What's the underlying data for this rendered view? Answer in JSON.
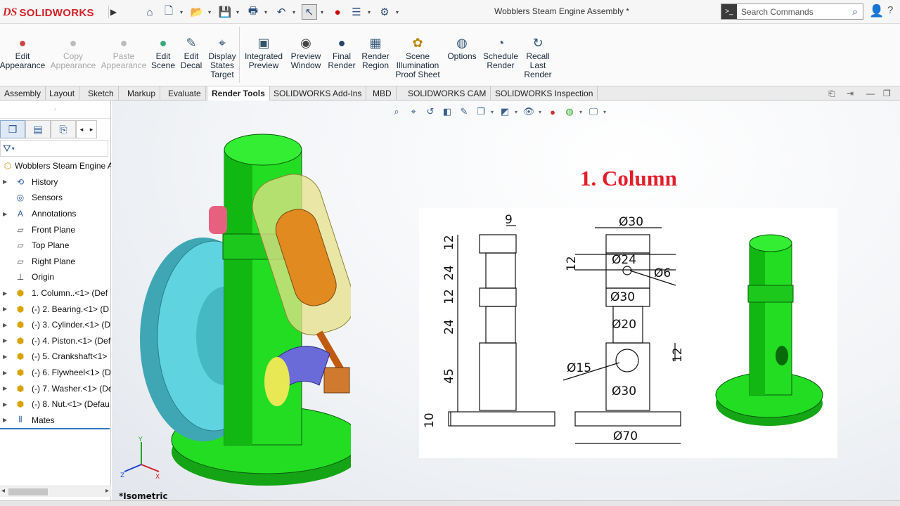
{
  "app": {
    "logo": {
      "mark": "DS",
      "name": "SOLIDWORKS"
    },
    "document_title": "Wobblers Steam Engine Assembly *",
    "search_placeholder": "Search Commands"
  },
  "quick_access": [
    "home-icon",
    "new-document-icon",
    "open-folder-icon",
    "save-icon",
    "print-icon",
    "undo-icon",
    "select-pointer-icon",
    "traffic-light-icon",
    "options-list-icon",
    "gear-icon"
  ],
  "ribbon": {
    "buttons": [
      {
        "label": "Edit\nAppearance",
        "enabled": true
      },
      {
        "label": "Copy\nAppearance",
        "enabled": false
      },
      {
        "label": "Paste\nAppearance",
        "enabled": false
      },
      {
        "label": "Edit\nScene",
        "enabled": true
      },
      {
        "label": "Edit\nDecal",
        "enabled": true
      },
      {
        "label": "Display\nStates\nTarget",
        "enabled": true
      },
      {
        "label": "Integrated\nPreview",
        "enabled": true
      },
      {
        "label": "Preview\nWindow",
        "enabled": true
      },
      {
        "label": "Final\nRender",
        "enabled": true
      },
      {
        "label": "Render\nRegion",
        "enabled": true
      },
      {
        "label": "Scene\nIllumination\nProof Sheet",
        "enabled": true
      },
      {
        "label": "Options",
        "enabled": true
      },
      {
        "label": "Schedule\nRender",
        "enabled": true
      },
      {
        "label": "Recall\nLast\nRender",
        "enabled": true
      }
    ]
  },
  "command_tabs": [
    "Assembly",
    "Layout",
    "Sketch",
    "Markup",
    "Evaluate",
    "Render Tools",
    "SOLIDWORKS Add-Ins",
    "MBD",
    "SOLIDWORKS CAM",
    "SOLIDWORKS Inspection"
  ],
  "active_tab": "Render Tools",
  "feature_tree": {
    "root": "Wobblers Steam Engine A",
    "items": [
      {
        "label": "History",
        "icon": "history-icon",
        "expandable": true
      },
      {
        "label": "Sensors",
        "icon": "sensors-icon",
        "expandable": false
      },
      {
        "label": "Annotations",
        "icon": "annotations-icon",
        "expandable": true
      },
      {
        "label": "Front Plane",
        "icon": "plane-icon",
        "expandable": false
      },
      {
        "label": "Top Plane",
        "icon": "plane-icon",
        "expandable": false
      },
      {
        "label": "Right Plane",
        "icon": "plane-icon",
        "expandable": false
      },
      {
        "label": "Origin",
        "icon": "origin-icon",
        "expandable": false
      },
      {
        "label": "1. Column..<1> (Def",
        "icon": "part-icon",
        "expandable": true
      },
      {
        "label": "(-) 2. Bearing.<1> (D",
        "icon": "part-icon",
        "expandable": true
      },
      {
        "label": "(-) 3. Cylinder.<1> (D",
        "icon": "part-icon",
        "expandable": true
      },
      {
        "label": "(-) 4. Piston.<1> (Def",
        "icon": "part-icon",
        "expandable": true
      },
      {
        "label": "(-) 5. Crankshaft<1>",
        "icon": "part-icon",
        "expandable": true
      },
      {
        "label": "(-) 6. Flywheel<1> (D",
        "icon": "part-icon",
        "expandable": true
      },
      {
        "label": "(-) 7. Washer.<1> (De",
        "icon": "part-icon",
        "expandable": true
      },
      {
        "label": "(-) 8. Nut.<1> (Defau",
        "icon": "part-icon",
        "expandable": true
      },
      {
        "label": "Mates",
        "icon": "mates-icon",
        "expandable": true
      }
    ]
  },
  "viewport": {
    "view_name": "*Isometric",
    "drawing_title": "1. Column",
    "dimensions": {
      "side": [
        "9",
        "12",
        "24",
        "12",
        "24",
        "45",
        "10"
      ],
      "front": [
        "Ø30",
        "12",
        "Ø24",
        "Ø6",
        "Ø30",
        "Ø20",
        "12",
        "Ø15",
        "Ø30",
        "Ø70"
      ]
    }
  },
  "colors": {
    "accent": "#e31e2a",
    "part_green": "#22dd22",
    "selection_blue": "#2f79c2"
  }
}
